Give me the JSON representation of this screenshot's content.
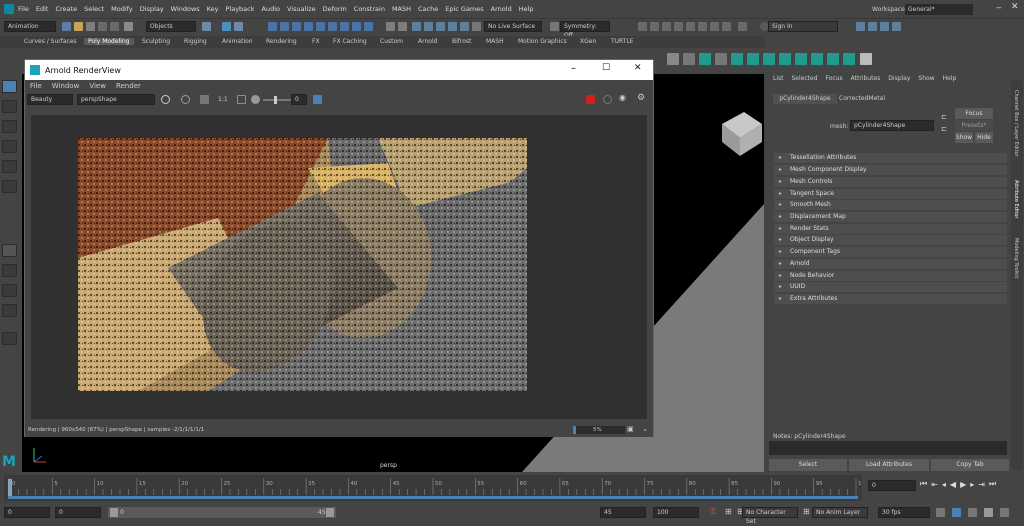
{
  "menubar": {
    "items": [
      "File",
      "Edit",
      "Create",
      "Select",
      "Modify",
      "Display",
      "Windows",
      "Key",
      "Playback",
      "Audio",
      "Visualize",
      "Deform",
      "Constrain",
      "MASH",
      "Cache",
      "Epic Games",
      "Arnold",
      "Help"
    ],
    "workspace_label": "Workspace :",
    "workspace_value": "General*"
  },
  "statusline": {
    "menuset": "Animation",
    "objects": "Objects",
    "no_live_surface": "No Live Surface",
    "symmetry": "Symmetry: Off",
    "sign_in": "Sign In"
  },
  "shelf": {
    "tabs": [
      "Curves / Surfaces",
      "Poly Modeling",
      "Sculpting",
      "Rigging",
      "Animation",
      "Rendering",
      "FX",
      "FX Caching",
      "Custom",
      "Arnold",
      "Bifrost",
      "MASH",
      "Motion Graphics",
      "XGen",
      "TURTLE"
    ],
    "active_tab": "Poly Modeling"
  },
  "renderview": {
    "title": "Arnold RenderView",
    "menu": [
      "File",
      "Window",
      "View",
      "Render"
    ],
    "aov": "Beauty",
    "camera": "perspShape",
    "ratio": "1:1",
    "exposure": "0",
    "status": "Rendering | 960x540 (87%) | perspShape | samples -2/1/1/1/1/1",
    "progress": "5%"
  },
  "viewport": {
    "camera_label": "persp"
  },
  "attribute_editor": {
    "menu": [
      "List",
      "Selected",
      "Focus",
      "Attributes",
      "Display",
      "Show",
      "Help"
    ],
    "tabs": [
      "pCylinder4Shape",
      "CorrectedMetal"
    ],
    "mesh_label": "mesh:",
    "mesh_value": "pCylinder4Shape",
    "focus_btn": "Focus",
    "presets_btn": "Presets*",
    "show_btn": "Show",
    "hide_btn": "Hide",
    "sections": [
      "Tessellation Attributes",
      "Mesh Component Display",
      "Mesh Controls",
      "Tangent Space",
      "Smooth Mesh",
      "Displacement Map",
      "Render Stats",
      "Object Display",
      "Component Tags",
      "Arnold",
      "Node Behavior",
      "UUID",
      "Extra Attributes"
    ],
    "notes": "Notes:  pCylinder4Shape",
    "select_btn": "Select",
    "load_btn": "Load Attributes",
    "copy_btn": "Copy Tab",
    "side_tabs": [
      "Channel Box / Layer Editor",
      "Attribute Editor",
      "Modeling Toolkit"
    ]
  },
  "timeline": {
    "ticks": [
      "0",
      "5",
      "10",
      "15",
      "20",
      "25",
      "30",
      "35",
      "40",
      "45",
      "50",
      "55",
      "60",
      "65",
      "70",
      "75",
      "80",
      "85",
      "90",
      "95",
      "100"
    ],
    "current_frame": "0"
  },
  "range": {
    "start": "0",
    "start_inner": "0",
    "slider_start": "0",
    "slider_end": "45",
    "end_inner": "45",
    "end": "100",
    "character_set": "No Character Set",
    "anim_layer": "No Anim Layer",
    "fps": "30 fps"
  }
}
